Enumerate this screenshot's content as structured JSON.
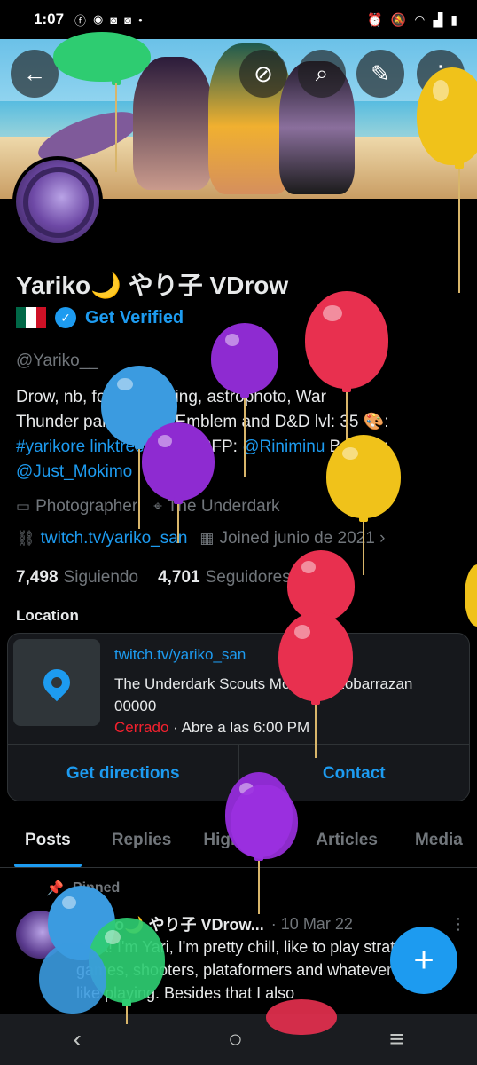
{
  "status_bar": {
    "time": "1:07",
    "notification_icons": [
      "facebook-icon",
      "messenger-icon",
      "discord-icon",
      "discord-icon",
      "dot-icon"
    ],
    "system_icons": [
      "alarm-icon",
      "mute-icon",
      "wifi-icon",
      "signal-icon",
      "battery-icon"
    ]
  },
  "header_actions": {
    "back": "←",
    "ring": "⊘",
    "search": "⌕",
    "edit": "✎",
    "more": "⋮"
  },
  "profile": {
    "display_name": "Yariko🌙 やり子 VDrow",
    "get_verified": "Get Verified",
    "handle": "@Yariko__",
    "bio": {
      "line1": "Drow, nb, food, camping, astrophoto, War",
      "line2": "Thunder partner Fire Emblem and D&D lvl: 35 🎨:",
      "link1": "#yarikore linktree/Yariko",
      "pfp_text": " PFP: ",
      "link2": "@Riniminu",
      "banner_text": " Banner:",
      "link3": "@Just_Mokimo"
    },
    "category": "Photographer",
    "location": "The Underdark",
    "website": "twitch.tv/yariko_san",
    "joined": "Joined junio de 2021",
    "following_count": "7,498",
    "following_label": "Siguiendo",
    "followers_count": "4,701",
    "followers_label": "Seguidores"
  },
  "location_card": {
    "section_label": "Location",
    "url": "twitch.tv/yariko_san",
    "address": "The Underdark Scouts Monterreyzobarrazan 00000",
    "status_closed": "Cerrado",
    "status_open": " · Abre a las 6:00 PM",
    "get_directions": "Get directions",
    "contact": "Contact"
  },
  "tabs": [
    "Posts",
    "Replies",
    "Highlights",
    "Articles",
    "Media"
  ],
  "pinned_post": {
    "pinned_label": "Pinned",
    "author": "Yariko🌙 やり子 VDrow...",
    "date": "· 10 Mar 22",
    "more": "⋮",
    "text": "Hiya! I'm Yari, I'm pretty chill, like to play strategy games, shooters, plataformers and whatever I feel like playing. Besides that I also"
  },
  "fab_label": "+",
  "nav": {
    "back": "‹",
    "home": "○",
    "recents": "≡"
  },
  "colors": {
    "accent": "#1d9bf0",
    "closed": "#f4212e",
    "balloon_green": "#2ecc71",
    "balloon_purple": "#8e2bd1",
    "balloon_blue": "#3b9be0",
    "balloon_red": "#e8304f",
    "balloon_yellow": "#f0c21a"
  }
}
